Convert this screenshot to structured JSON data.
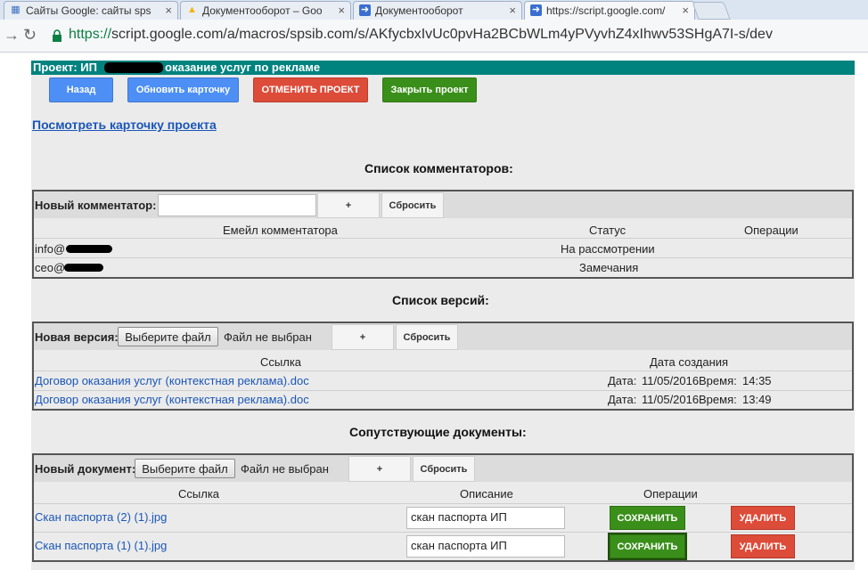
{
  "browser": {
    "tabs": [
      {
        "title": "Сайты Google: сайты sps",
        "icon": "sites-icon"
      },
      {
        "title": "Документооборот – Goo",
        "icon": "drive-icon"
      },
      {
        "title": "Документооборот",
        "icon": "arrow-icon"
      },
      {
        "title": "https://script.google.com/",
        "icon": "arrow-icon",
        "active": true
      }
    ],
    "url_scheme": "https://",
    "url_rest": "script.google.com/a/macros/spsib.com/s/AKfycbxIvUc0pvHa2BCbWLm4yPVyvhZ4xIhwv53SHgA7I-s/dev"
  },
  "project": {
    "title_prefix": "Проект: ИП",
    "title_suffix": "оказание услуг по рекламе",
    "buttons": {
      "back": "Назад",
      "refresh_card": "Обновить карточку",
      "cancel_project": "ОТМЕНИТЬ ПРОЕКТ",
      "close_project": "Закрыть проект"
    },
    "view_card_link": "Посмотреть карточку проекта"
  },
  "commenters": {
    "heading": "Список комментаторов:",
    "new_label": "Новый комментатор:",
    "input_value": "",
    "add_label": "+",
    "reset_label": "Сбросить",
    "columns": [
      "Емейл комментатора",
      "Статус",
      "Операции"
    ],
    "rows": [
      {
        "email": "info@",
        "status": "На рассмотрении"
      },
      {
        "email": "ceo@",
        "status": "Замечания"
      }
    ]
  },
  "versions": {
    "heading": "Список версий:",
    "new_label": "Новая версия:",
    "choose_file": "Выберите файл",
    "no_file": "Файл не выбран",
    "add_label": "+",
    "reset_label": "Сбросить",
    "columns": [
      "Ссылка",
      "Дата создания"
    ],
    "rows": [
      {
        "link": "Договор оказания услуг (контекстная реклама).doc",
        "date_label": "Дата:",
        "date": "11/05/2016",
        "time_label": "Время:",
        "time": "14:35"
      },
      {
        "link": "Договор оказания услуг (контекстная реклама).doc",
        "date_label": "Дата:",
        "date": "11/05/2016",
        "time_label": "Время:",
        "time": "13:49"
      }
    ]
  },
  "documents": {
    "heading": "Сопутствующие документы:",
    "new_label": "Новый документ:",
    "choose_file": "Выберите файл",
    "no_file": "Файл не выбран",
    "add_label": "+",
    "reset_label": "Сбросить",
    "columns": [
      "Ссылка",
      "Описание",
      "Операции"
    ],
    "save_label": "СОХРАНИТЬ",
    "delete_label": "УДАЛИТЬ",
    "rows": [
      {
        "link": "Скан паспорта (2) (1).jpg",
        "description": "скан паспорта ИП"
      },
      {
        "link": "Скан паспорта (1) (1).jpg",
        "description": "скан паспорта ИП"
      }
    ]
  }
}
